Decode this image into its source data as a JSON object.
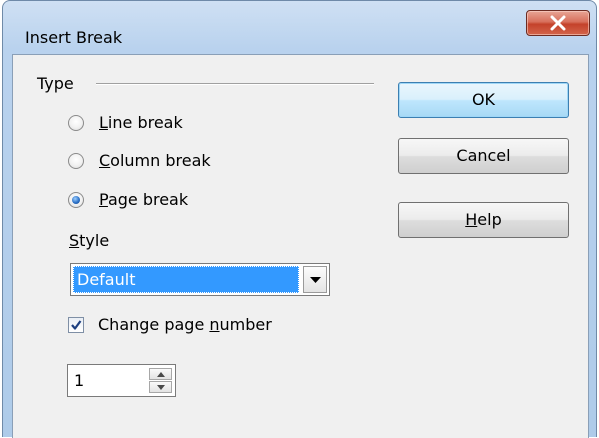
{
  "window": {
    "title": "Insert Break"
  },
  "type_group": {
    "label": "Type",
    "options": [
      {
        "label_pre": "",
        "label_mnemonic": "L",
        "label_post": "ine break",
        "checked": false
      },
      {
        "label_pre": "",
        "label_mnemonic": "C",
        "label_post": "olumn break",
        "checked": false
      },
      {
        "label_pre": "",
        "label_mnemonic": "P",
        "label_post": "age break",
        "checked": true
      }
    ]
  },
  "style": {
    "label_mnemonic": "S",
    "label_post": "tyle",
    "selected": "Default"
  },
  "change_page_number": {
    "label_pre": "Change page ",
    "label_mnemonic": "n",
    "label_post": "umber",
    "checked": true
  },
  "page_number": {
    "value": "1"
  },
  "buttons": {
    "ok": "OK",
    "cancel": "Cancel",
    "help_mnemonic": "H",
    "help_post": "elp"
  },
  "colors": {
    "selection": "#3399ff",
    "close_button": "#c4422b"
  }
}
